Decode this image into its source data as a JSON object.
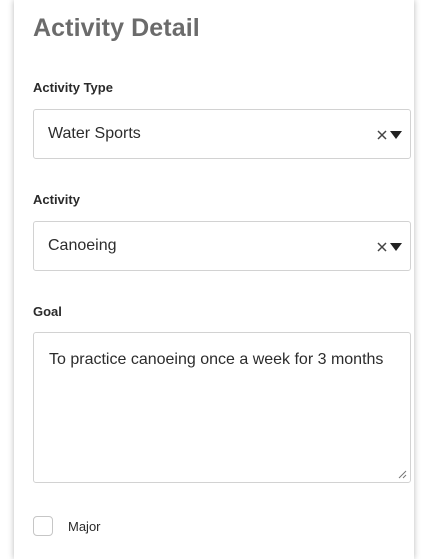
{
  "form": {
    "title": "Activity Detail",
    "activity_type": {
      "label": "Activity Type",
      "value": "Water Sports"
    },
    "activity": {
      "label": "Activity",
      "value": "Canoeing"
    },
    "goal": {
      "label": "Goal",
      "value": "To practice canoeing once a week for 3 months"
    },
    "major": {
      "label": "Major",
      "checked": false
    }
  },
  "icons": {
    "clear": "close-icon",
    "dropdown": "caret-down-icon",
    "resize": "resize-handle-icon"
  },
  "colors": {
    "title": "#6b6b6b",
    "border": "#d2d2d2",
    "text": "#2c2c2c"
  }
}
